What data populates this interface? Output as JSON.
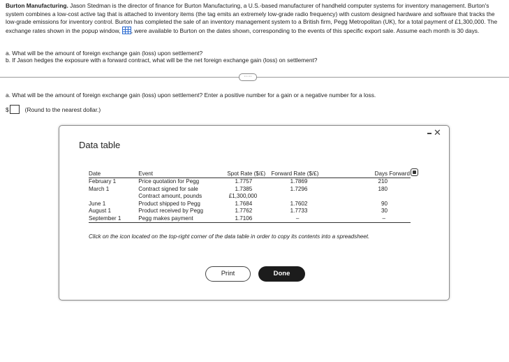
{
  "problem": {
    "title": "Burton Manufacturing.",
    "text_part1": "Jason Stedman is the director of finance for Burton Manufacturing, a U.S.-based manufacturer of handheld computer systems for inventory management. Burton's system combines a low-cost active tag that is attached to inventory items (the tag emits an extremely low-grade radio frequency) with custom designed hardware and software that tracks the low-grade emissions for inventory control. Burton has completed the sale of an inventory management system to a British firm, Pegg Metropolitan (UK), for a total payment of £1,300,000. The exchange rates shown in the popup window,",
    "text_part2": ", were available to Burton on the dates shown, corresponding to the events of this specific export sale. Assume each month is 30 days."
  },
  "questions": {
    "a": "a. What will be the amount of foreign exchange gain (loss) upon settlement?",
    "b": "b. If Jason hedges the exposure with a forward contract, what will be the net foreign exchange gain (loss) on settlement?"
  },
  "more_button": "·····",
  "part_a": {
    "question": "a. What will be the amount of foreign exchange gain (loss) upon settlement? Enter a positive number for a gain or a negative number for a loss.",
    "currency": "$",
    "hint": "(Round to the nearest dollar.)"
  },
  "modal": {
    "title": "Data table",
    "minimize": "-",
    "close": "✕",
    "headers": {
      "date": "Date",
      "event": "Event",
      "spot": "Spot Rate ($/£)",
      "forward": "Forward Rate ($/£)",
      "days": "Days Forward"
    },
    "rows": [
      {
        "date": "February 1",
        "event": "Price quotation for Pegg",
        "spot": "1.7757",
        "forward": "1.7869",
        "days": "210"
      },
      {
        "date": "March 1",
        "event": "Contract signed for sale",
        "spot": "1.7385",
        "forward": "1.7296",
        "days": "180"
      },
      {
        "date": "",
        "event": "Contract amount, pounds",
        "spot": "£1,300,000",
        "forward": "",
        "days": ""
      },
      {
        "date": "June 1",
        "event": "Product shipped to Pegg",
        "spot": "1.7684",
        "forward": "1.7602",
        "days": "90"
      },
      {
        "date": "August 1",
        "event": "Product received by Pegg",
        "spot": "1.7762",
        "forward": "1.7733",
        "days": "30"
      },
      {
        "date": "September 1",
        "event": "Pegg makes payment",
        "spot": "1.7106",
        "forward": "–",
        "days": "–"
      }
    ],
    "note": "Click on the icon located on the top-right corner of the data table in order to copy its contents into a spreadsheet.",
    "print_label": "Print",
    "done_label": "Done"
  }
}
